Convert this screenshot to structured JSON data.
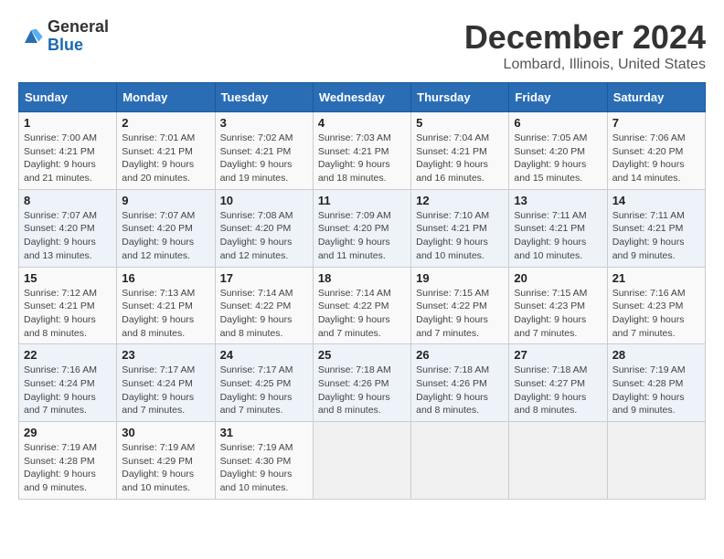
{
  "logo": {
    "line1": "General",
    "line2": "Blue"
  },
  "title": "December 2024",
  "subtitle": "Lombard, Illinois, United States",
  "header_color": "#2a6db5",
  "days_of_week": [
    "Sunday",
    "Monday",
    "Tuesday",
    "Wednesday",
    "Thursday",
    "Friday",
    "Saturday"
  ],
  "weeks": [
    [
      {
        "day": 1,
        "sunrise": "7:00 AM",
        "sunset": "4:21 PM",
        "daylight": "9 hours and 21 minutes."
      },
      {
        "day": 2,
        "sunrise": "7:01 AM",
        "sunset": "4:21 PM",
        "daylight": "9 hours and 20 minutes."
      },
      {
        "day": 3,
        "sunrise": "7:02 AM",
        "sunset": "4:21 PM",
        "daylight": "9 hours and 19 minutes."
      },
      {
        "day": 4,
        "sunrise": "7:03 AM",
        "sunset": "4:21 PM",
        "daylight": "9 hours and 18 minutes."
      },
      {
        "day": 5,
        "sunrise": "7:04 AM",
        "sunset": "4:21 PM",
        "daylight": "9 hours and 16 minutes."
      },
      {
        "day": 6,
        "sunrise": "7:05 AM",
        "sunset": "4:20 PM",
        "daylight": "9 hours and 15 minutes."
      },
      {
        "day": 7,
        "sunrise": "7:06 AM",
        "sunset": "4:20 PM",
        "daylight": "9 hours and 14 minutes."
      }
    ],
    [
      {
        "day": 8,
        "sunrise": "7:07 AM",
        "sunset": "4:20 PM",
        "daylight": "9 hours and 13 minutes."
      },
      {
        "day": 9,
        "sunrise": "7:07 AM",
        "sunset": "4:20 PM",
        "daylight": "9 hours and 12 minutes."
      },
      {
        "day": 10,
        "sunrise": "7:08 AM",
        "sunset": "4:20 PM",
        "daylight": "9 hours and 12 minutes."
      },
      {
        "day": 11,
        "sunrise": "7:09 AM",
        "sunset": "4:20 PM",
        "daylight": "9 hours and 11 minutes."
      },
      {
        "day": 12,
        "sunrise": "7:10 AM",
        "sunset": "4:21 PM",
        "daylight": "9 hours and 10 minutes."
      },
      {
        "day": 13,
        "sunrise": "7:11 AM",
        "sunset": "4:21 PM",
        "daylight": "9 hours and 10 minutes."
      },
      {
        "day": 14,
        "sunrise": "7:11 AM",
        "sunset": "4:21 PM",
        "daylight": "9 hours and 9 minutes."
      }
    ],
    [
      {
        "day": 15,
        "sunrise": "7:12 AM",
        "sunset": "4:21 PM",
        "daylight": "9 hours and 8 minutes."
      },
      {
        "day": 16,
        "sunrise": "7:13 AM",
        "sunset": "4:21 PM",
        "daylight": "9 hours and 8 minutes."
      },
      {
        "day": 17,
        "sunrise": "7:14 AM",
        "sunset": "4:22 PM",
        "daylight": "9 hours and 8 minutes."
      },
      {
        "day": 18,
        "sunrise": "7:14 AM",
        "sunset": "4:22 PM",
        "daylight": "9 hours and 7 minutes."
      },
      {
        "day": 19,
        "sunrise": "7:15 AM",
        "sunset": "4:22 PM",
        "daylight": "9 hours and 7 minutes."
      },
      {
        "day": 20,
        "sunrise": "7:15 AM",
        "sunset": "4:23 PM",
        "daylight": "9 hours and 7 minutes."
      },
      {
        "day": 21,
        "sunrise": "7:16 AM",
        "sunset": "4:23 PM",
        "daylight": "9 hours and 7 minutes."
      }
    ],
    [
      {
        "day": 22,
        "sunrise": "7:16 AM",
        "sunset": "4:24 PM",
        "daylight": "9 hours and 7 minutes."
      },
      {
        "day": 23,
        "sunrise": "7:17 AM",
        "sunset": "4:24 PM",
        "daylight": "9 hours and 7 minutes."
      },
      {
        "day": 24,
        "sunrise": "7:17 AM",
        "sunset": "4:25 PM",
        "daylight": "9 hours and 7 minutes."
      },
      {
        "day": 25,
        "sunrise": "7:18 AM",
        "sunset": "4:26 PM",
        "daylight": "9 hours and 8 minutes."
      },
      {
        "day": 26,
        "sunrise": "7:18 AM",
        "sunset": "4:26 PM",
        "daylight": "9 hours and 8 minutes."
      },
      {
        "day": 27,
        "sunrise": "7:18 AM",
        "sunset": "4:27 PM",
        "daylight": "9 hours and 8 minutes."
      },
      {
        "day": 28,
        "sunrise": "7:19 AM",
        "sunset": "4:28 PM",
        "daylight": "9 hours and 9 minutes."
      }
    ],
    [
      {
        "day": 29,
        "sunrise": "7:19 AM",
        "sunset": "4:28 PM",
        "daylight": "9 hours and 9 minutes."
      },
      {
        "day": 30,
        "sunrise": "7:19 AM",
        "sunset": "4:29 PM",
        "daylight": "9 hours and 10 minutes."
      },
      {
        "day": 31,
        "sunrise": "7:19 AM",
        "sunset": "4:30 PM",
        "daylight": "9 hours and 10 minutes."
      },
      null,
      null,
      null,
      null
    ]
  ]
}
